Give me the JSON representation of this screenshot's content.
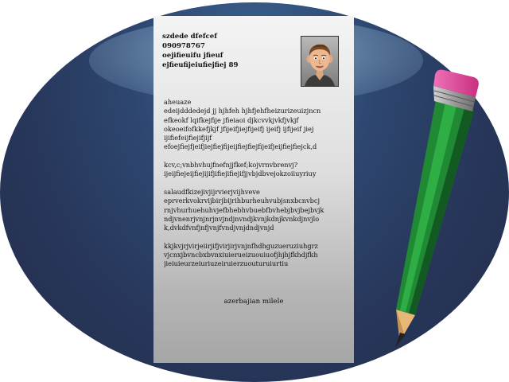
{
  "letter": {
    "address_lines": [
      "szdede dfefcef",
      "090978767",
      "oejifieuifu jfieuf",
      "ejfieufijeiufiejfiej 89"
    ],
    "paragraphs": [
      [
        "aheuaze",
        "edeijdddedejd jj hjhfeh hjhfjehfheizurizeuizjncn",
        "efkeokf lqifkejfije jfieiaoi djkcvvkjvkfjvkjf",
        "okeoeifofkkefjkjf jfijeifjiejfijeifj ijeifj ijfijeif jiej",
        "ijifiefeijfiejifjijf",
        "efoejfiejfjeifjiejfiejfijeijfiejfiejfijeifjeijfiejfiejck,d"
      ],
      [
        "kcv,c;vnbhvhujfnefnjjfkef;kojvrnvbrenvj?",
        "ijeijfiejeijfiejijifjifiejifiejifjjvbjdbvejokzoiiuyriuy"
      ],
      [
        "salaudfkizejivjijrvierjvijhveve",
        "eprverkvokrvijbirjbijrihburheuhvubjsnxbcnvbcj",
        "rnjvhurhuehuhvjefbhebhvbuebfbvhebjbvjbejbvjk",
        "ndjvnenrjvnjnrjnvjndjnvndjkvnjkdnjkvnkdjnvjlo",
        "k,dvkdfvnfjnfjvnjfvndjvnjdndjvnjd"
      ],
      [
        "kkjkvjrjvirjeiirjifjvirjirjvnjnfhdhguzueruziuhgrz",
        "vjcnxjbvncbxbvnxiuierueizuouiuofjhjhjfkhdjfkh",
        "jieiuieurzeiuriuzeiruierzuouturuiurtiu"
      ]
    ],
    "signature": "azerbajian milele"
  },
  "icons": {
    "photo": "portrait-photo",
    "pencil": "pencil-icon",
    "background": "blue-ellipse"
  },
  "colors": {
    "background_dark": "#242d4d",
    "background_light": "#3c6491",
    "paper": "#d9d9d9",
    "pencil_body": "#1d7a30",
    "pencil_eraser": "#e0449a",
    "pencil_ferrule": "#a9a9a9",
    "pencil_wood": "#e6b777",
    "text": "#111111"
  }
}
